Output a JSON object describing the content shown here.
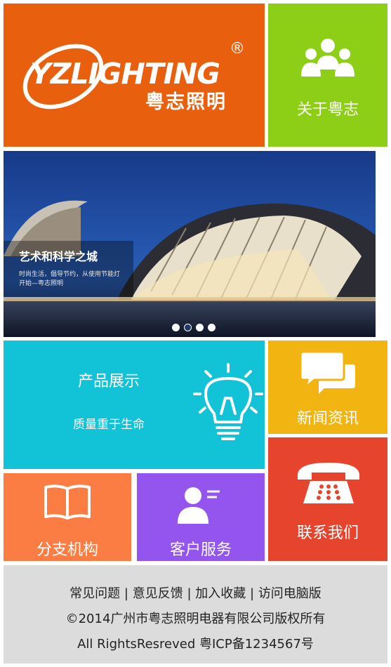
{
  "brand": {
    "logo_text": "YZLIGHTING",
    "logo_cn": "粤志照明",
    "reg": "®"
  },
  "tiles": {
    "about": "关于粤志",
    "product": "产品展示",
    "product_sub": "质量重于生命",
    "news": "新闻资讯",
    "contact": "联系我们",
    "branch": "分支机构",
    "service": "客户服务"
  },
  "banner": {
    "title": "艺术和科学之城",
    "subtitle_line1": "时尚生活，倡导节约，从使用节能灯",
    "subtitle_line2": "开始—粤志照明",
    "slides": 4,
    "active_slide": 2
  },
  "footer": {
    "links": [
      "常见问题",
      "意见反馈",
      "加入收藏",
      "访问电脑版"
    ],
    "separator": "|",
    "copyright": "©2014广州市粤志照明电器有限公司版权所有",
    "rights": "All RightsResreved 粤ICP备1234567号"
  },
  "colors": {
    "logo_bg": "#e8600e",
    "about_bg": "#8ccf16",
    "product_bg": "#12c2d6",
    "news_bg": "#f2b411",
    "contact_bg": "#e7442e",
    "branch_bg": "#fb7d43",
    "service_bg": "#9454ee",
    "footer_bg": "#dcdcdc"
  }
}
